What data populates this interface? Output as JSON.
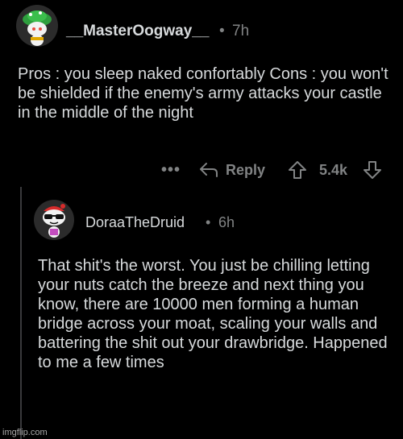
{
  "comments": [
    {
      "author": "__MasterOogway__",
      "separator": "•",
      "time": "7h",
      "body": "Pros : you sleep naked confortably Cons : you won't be shielded if the enemy's army attacks your castle in the middle of the night",
      "actions": {
        "more_label": "•••",
        "reply_label": "Reply",
        "score": "5.4k"
      },
      "avatar_icon": "snoo-avatar-green-hat"
    },
    {
      "author": "DoraaTheDruid",
      "separator": "•",
      "time": "6h",
      "body": "That shit's the worst. You just be chilling letting your nuts catch the breeze and next thing you know, there are 10000 men forming a human bridge across your moat, scaling your walls and battering the shit out your drawbridge. Happened to me a few times",
      "avatar_icon": "snoo-avatar-sunglasses"
    }
  ],
  "watermark": "imgflip.com",
  "colors": {
    "background": "#000000",
    "text": "#d7dadc",
    "meta": "#818384"
  }
}
